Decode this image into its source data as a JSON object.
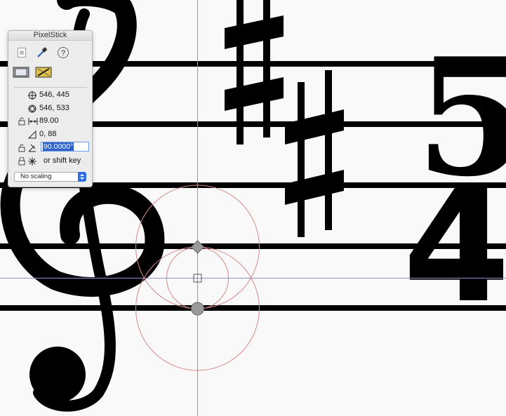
{
  "palette": {
    "title": "PixelStick",
    "toolbar": [
      {
        "name": "lock-document-icon"
      },
      {
        "name": "eyedropper-icon"
      },
      {
        "name": "help-icon",
        "glyph": "?"
      },
      {
        "name": "screenshot-icon"
      },
      {
        "name": "ruler-guide-icon"
      }
    ],
    "point1": "546, 445",
    "point2": "546, 533",
    "distance": "89.00",
    "delta": "0, 88",
    "angle": "90.0000°",
    "shift_hint": "or shift key",
    "scaling": "No scaling"
  },
  "canvas": {
    "background": "#f9f9f9",
    "ink": "#000000",
    "guide_color": "#8f8fd0",
    "circle_color": "#d48a8a",
    "time_signature": {
      "top": "5",
      "bottom": "4"
    }
  }
}
